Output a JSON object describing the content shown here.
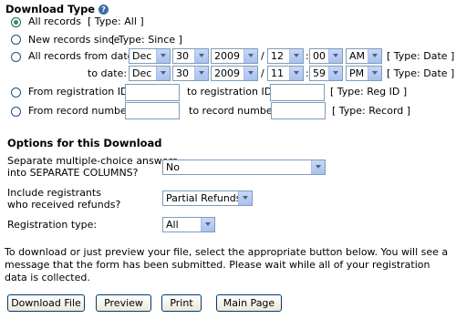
{
  "download_type": {
    "title": "Download Type",
    "help_icon": "?",
    "options": {
      "all_records": {
        "label": "All records",
        "type": "[ Type: All ]",
        "checked": true
      },
      "new_since": {
        "label": "New records since",
        "type": "[ Type: Since ]",
        "checked": false
      },
      "from_date": {
        "label": "All records from date:",
        "to_label": "to date:",
        "type": "[ Type: Date ]",
        "from": {
          "month": "Dec",
          "day": "30",
          "year": "2009",
          "hour": "12",
          "minute": "00",
          "ampm": "AM"
        },
        "to": {
          "month": "Dec",
          "day": "30",
          "year": "2009",
          "hour": "11",
          "minute": "59",
          "ampm": "PM"
        },
        "slash": "/",
        "colon": ":",
        "checked": false
      },
      "reg_id": {
        "label": "From registration ID:",
        "to_label": "to registration ID:",
        "type": "[ Type: Reg ID ]",
        "from_value": "",
        "to_value": "",
        "checked": false
      },
      "record_num": {
        "label": "From record number:",
        "to_label": "to record number:",
        "type": "[ Type: Record ]",
        "from_value": "",
        "to_value": "",
        "checked": false
      }
    }
  },
  "options": {
    "title": "Options for this Download",
    "separate": {
      "label_line1": "Separate multiple-choice answers",
      "label_line2": "into SEPARATE COLUMNS?",
      "value": "No"
    },
    "refunds": {
      "label_line1": "Include registrants",
      "label_line2": "who received refunds?",
      "value": "Partial Refunds"
    },
    "reg_type": {
      "label": "Registration type:",
      "value": "All"
    }
  },
  "instructions": "To download or just preview your file, select the appropriate button below. You will see a message that the form has been submitted. Please wait while all of your registration data is collected.",
  "buttons": {
    "download": "Download File",
    "preview": "Preview",
    "print": "Print",
    "main": "Main Page"
  }
}
